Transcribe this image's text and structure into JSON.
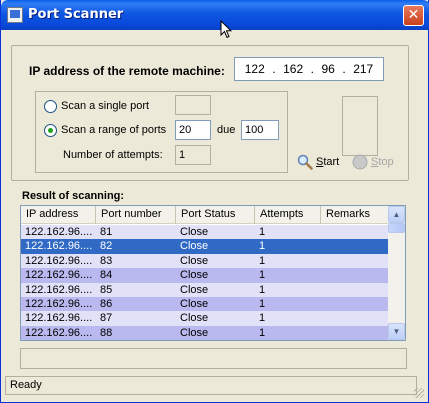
{
  "window": {
    "title": "Port Scanner",
    "close_glyph": "✕"
  },
  "ip": {
    "label": "IP address of the remote machine:",
    "octets": [
      "122",
      "162",
      "96",
      "217"
    ]
  },
  "scan_options": {
    "single_port_label": "Scan a single port",
    "single_port_value": "",
    "range_label": "Scan a range of ports",
    "range_from": "20",
    "range_sep": "due",
    "range_to": "100",
    "selected": "range",
    "attempts_label": "Number of attempts:",
    "attempts_value": "1"
  },
  "buttons": {
    "start": "Start",
    "start_accel": "S",
    "start_rest": "tart",
    "stop": "Stop",
    "stop_accel": "S",
    "stop_rest": "top"
  },
  "results": {
    "label": "Result of scanning:",
    "columns": [
      "IP address",
      "Port number",
      "Port Status",
      "Attempts",
      "Remarks"
    ],
    "rows": [
      [
        "122.162.96....",
        "81",
        "Close",
        "1",
        ""
      ],
      [
        "122.162.96....",
        "82",
        "Close",
        "1",
        ""
      ],
      [
        "122.162.96....",
        "83",
        "Close",
        "1",
        ""
      ],
      [
        "122.162.96....",
        "84",
        "Close",
        "1",
        ""
      ],
      [
        "122.162.96....",
        "85",
        "Close",
        "1",
        ""
      ],
      [
        "122.162.96....",
        "86",
        "Close",
        "1",
        ""
      ],
      [
        "122.162.96....",
        "87",
        "Close",
        "1",
        ""
      ],
      [
        "122.162.96....",
        "88",
        "Close",
        "1",
        ""
      ]
    ],
    "selected_row": 1
  },
  "progress": {
    "fraction": 0
  },
  "status": {
    "text": "Ready"
  },
  "colors": {
    "title_bar": "#0a5fe8",
    "selection": "#316ac5",
    "row_light": "#e1e1f7",
    "row_dark": "#b9b9ef"
  },
  "icons": {
    "app": "app-icon",
    "close": "close-icon",
    "start": "magnifier-icon",
    "stop": "stop-icon"
  }
}
